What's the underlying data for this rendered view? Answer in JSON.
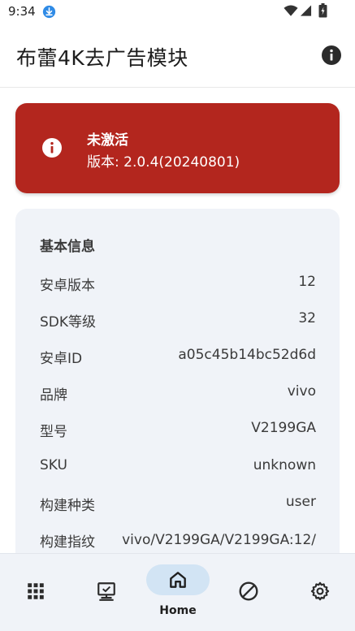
{
  "status_bar": {
    "time": "9:34"
  },
  "app_bar": {
    "title": "布蕾4K去广告模块"
  },
  "status_card": {
    "title": "未激活",
    "version": "版本: 2.0.4(20240801)",
    "color": "#b3261e"
  },
  "info_card": {
    "title": "基本信息",
    "rows": [
      {
        "label": "安卓版本",
        "value": "12"
      },
      {
        "label": "SDK等级",
        "value": "32"
      },
      {
        "label": "安卓ID",
        "value": "a05c45b14bc52d6d"
      },
      {
        "label": "品牌",
        "value": "vivo"
      },
      {
        "label": "型号",
        "value": "V2199GA"
      },
      {
        "label": "SKU",
        "value": "unknown"
      },
      {
        "label": "构建种类",
        "value": "user"
      },
      {
        "label": "构建指纹",
        "value": "vivo/V2199GA/V2199GA:12/"
      }
    ]
  },
  "bottom_nav": {
    "items": [
      {
        "icon": "apps-grid-icon"
      },
      {
        "icon": "monitor-icon"
      },
      {
        "icon": "home-icon",
        "label": "Home",
        "selected": true
      },
      {
        "icon": "block-icon"
      },
      {
        "icon": "settings-gear-icon"
      }
    ],
    "active_pill_color": "#d2e4f4"
  }
}
